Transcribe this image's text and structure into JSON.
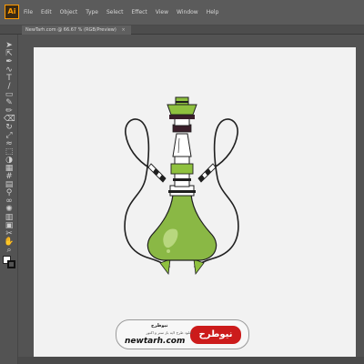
{
  "app": {
    "logo_label": "Ai"
  },
  "menu": {
    "items": [
      "File",
      "Edit",
      "Object",
      "Type",
      "Select",
      "Effect",
      "View",
      "Window",
      "Help"
    ]
  },
  "document": {
    "tab_title": "NewTarh.com @ 66.67 % (RGB/Preview)",
    "close_glyph": "×"
  },
  "toolbar": {
    "tools": [
      "selection-tool",
      "direct-selection-tool",
      "pen-tool",
      "curvature-tool",
      "type-tool",
      "line-tool",
      "rectangle-tool",
      "paintbrush-tool",
      "pencil-tool",
      "eraser-tool",
      "rotate-tool",
      "scale-tool",
      "warp-tool",
      "free-transform-tool",
      "shape-builder-tool",
      "perspective-grid-tool",
      "mesh-tool",
      "gradient-tool",
      "eyedropper-tool",
      "blend-tool",
      "symbol-sprayer-tool",
      "graph-tool",
      "artboard-tool",
      "slice-tool",
      "hand-tool",
      "zoom-tool"
    ],
    "tool_glyphs": [
      "➤",
      "⇱",
      "✒",
      "∿",
      "T",
      "/",
      "▭",
      "✎",
      "✏",
      "⌫",
      "↻",
      "⤢",
      "≈",
      "⬚",
      "◑",
      "▦",
      "#",
      "▤",
      "⚲",
      "∞",
      "✺",
      "▥",
      "▣",
      "✂",
      "✋",
      "⌕"
    ]
  },
  "colors": {
    "bowl_green": "#8ab845",
    "bowl_highlight": "#b8d77e",
    "outline": "#1f1f1f",
    "accent_green": "#8fc13f",
    "cap_dark": "#3a1e2a",
    "artboard": "#f2f2f2",
    "workspace": "#535353",
    "watermark_red": "#cc1b1b"
  },
  "watermark": {
    "logo_text": "نیوطرح",
    "name": "نیوطرح",
    "tagline": "دانلود طرح لایه باز ستر و اکتور",
    "url": "newtarh.com"
  }
}
